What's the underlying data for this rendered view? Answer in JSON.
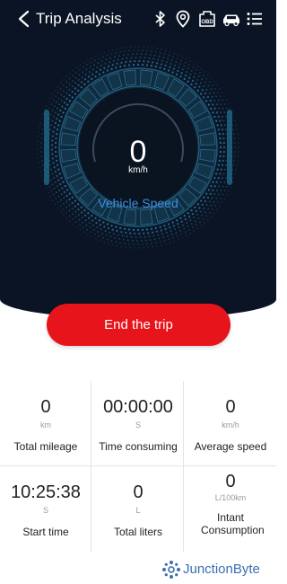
{
  "header": {
    "title": "Trip Analysis",
    "icons": [
      "back-icon",
      "bluetooth-icon",
      "location-icon",
      "obd-icon",
      "car-icon",
      "list-icon"
    ],
    "obd_text": "OBD"
  },
  "gauge": {
    "speed": "0",
    "unit": "km/h",
    "label": "Vehicle Speed",
    "accent": "#3d8ee0"
  },
  "actions": {
    "end_trip": "End the trip",
    "end_trip_color": "#e8141b"
  },
  "stats": [
    {
      "value": "0",
      "unit": "km",
      "label": "Total mileage"
    },
    {
      "value": "00:00:00",
      "unit": "S",
      "label": "Time consuming"
    },
    {
      "value": "0",
      "unit": "km/h",
      "label": "Average speed"
    },
    {
      "value": "10:25:38",
      "unit": "S",
      "label": "Start time"
    },
    {
      "value": "0",
      "unit": "L",
      "label": "Total liters"
    },
    {
      "value": "0",
      "unit": "L/100km",
      "label": "Intant Consumption"
    }
  ],
  "brand": {
    "name": "JunctionByte",
    "color": "#3a6fb0"
  }
}
